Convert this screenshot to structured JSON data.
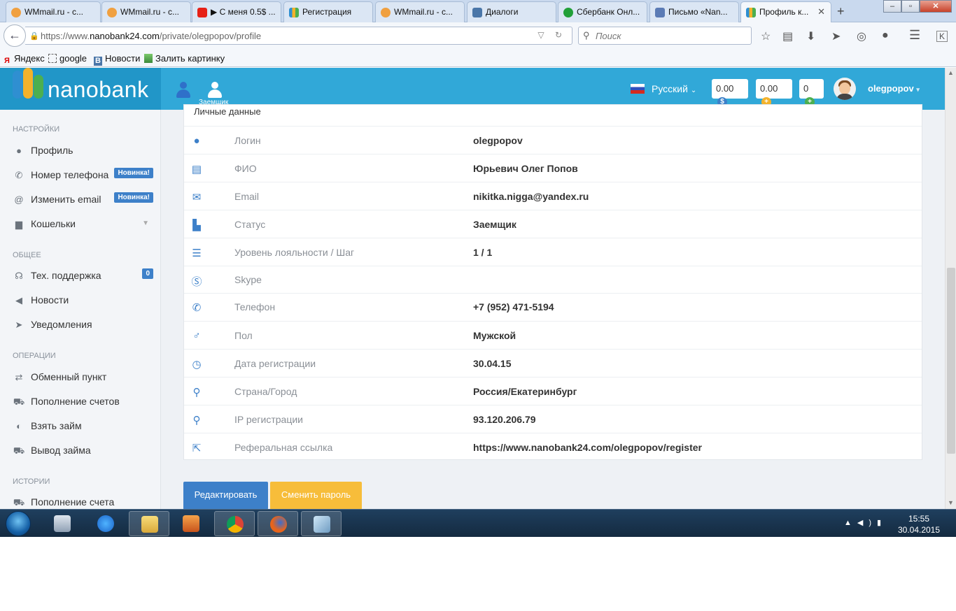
{
  "browser": {
    "tabs": [
      {
        "title": "WMmail.ru - с...",
        "icon": "wmmail-icon",
        "color": "#f0a040"
      },
      {
        "title": "WMmail.ru - с...",
        "icon": "wmmail-icon",
        "color": "#f0a040"
      },
      {
        "title": "▶ С меня 0.5$ ...",
        "icon": "youtube-icon",
        "color": "#e62117"
      },
      {
        "title": "Регистрация",
        "icon": "nanobank-icon",
        "color": "#4caf50"
      },
      {
        "title": "WMmail.ru - с...",
        "icon": "wmmail-icon",
        "color": "#f0a040"
      },
      {
        "title": "Диалоги",
        "icon": "vk-icon",
        "color": "#4a76a8"
      },
      {
        "title": "Сбербанк Онл...",
        "icon": "sberbank-icon",
        "color": "#21a038"
      },
      {
        "title": "Письмо «Nan...",
        "icon": "mail-icon",
        "color": "#5b7bb5"
      },
      {
        "title": "Профиль к...",
        "icon": "nanobank-icon",
        "color": "#4caf50",
        "active": true
      }
    ],
    "url_prefix": "https://www.",
    "url_host": "nanobank24.com",
    "url_path": "/private/olegpopov/profile",
    "search_placeholder": "Поиск",
    "bookmarks": [
      {
        "label": "Яндекс",
        "icon": "yandex-icon"
      },
      {
        "label": "google",
        "icon": "dashed-square-icon"
      },
      {
        "label": "Новости",
        "icon": "vk-icon"
      },
      {
        "label": "Залить картинку",
        "icon": "image-upload-icon"
      }
    ]
  },
  "header": {
    "logo_text": "nanobank",
    "role_label": "Заемщик",
    "language": "Русский",
    "balances": [
      "0.00",
      "0.00",
      "0"
    ],
    "username": "olegpopov"
  },
  "sidebar": {
    "sections": [
      {
        "title": "НАСТРОЙКИ",
        "items": [
          {
            "label": "Профиль",
            "icon": "user-icon"
          },
          {
            "label": "Номер телефона",
            "icon": "phone-icon",
            "badge": "Новинка!"
          },
          {
            "label": "Изменить email",
            "icon": "at-icon",
            "badge": "Новинка!"
          },
          {
            "label": "Кошельки",
            "icon": "wallet-icon",
            "caret": true
          }
        ]
      },
      {
        "title": "ОБЩЕЕ",
        "items": [
          {
            "label": "Тех. поддержка",
            "icon": "headset-icon",
            "badge": "0"
          },
          {
            "label": "Новости",
            "icon": "megaphone-icon"
          },
          {
            "label": "Уведомления",
            "icon": "paper-plane-icon"
          }
        ]
      },
      {
        "title": "ОПЕРАЦИИ",
        "items": [
          {
            "label": "Обменный пункт",
            "icon": "exchange-icon"
          },
          {
            "label": "Пополнение счетов",
            "icon": "cart-icon"
          },
          {
            "label": "Взять займ",
            "icon": "arrow-circle-icon"
          },
          {
            "label": "Вывод займа",
            "icon": "cart-icon"
          }
        ]
      },
      {
        "title": "ИСТОРИИ",
        "items": [
          {
            "label": "Пополнение счета",
            "icon": "cart-icon"
          }
        ]
      }
    ]
  },
  "profile": {
    "section_title": "Личные данные",
    "rows": [
      {
        "icon": "user-icon",
        "label": "Логин",
        "value": "olegpopov"
      },
      {
        "icon": "clipboard-icon",
        "label": "ФИО",
        "value": "Юрьевич Олег Попов"
      },
      {
        "icon": "envelope-icon",
        "label": "Email",
        "value": "nikitka.nigga@yandex.ru"
      },
      {
        "icon": "bar-chart-icon",
        "label": "Статус",
        "value": "Заемщик"
      },
      {
        "icon": "list-icon",
        "label": "Уровень лояльности / Шаг",
        "value": "1 / 1"
      },
      {
        "icon": "skype-icon",
        "label": "Skype",
        "value": ""
      },
      {
        "icon": "phone-icon",
        "label": "Телефон",
        "value": "+7 (952) 471-5194"
      },
      {
        "icon": "male-icon",
        "label": "Пол",
        "value": "Мужской"
      },
      {
        "icon": "clock-icon",
        "label": "Дата регистрации",
        "value": "30.04.15"
      },
      {
        "icon": "map-marker-icon",
        "label": "Страна/Город",
        "value": "Россия/Екатеринбург"
      },
      {
        "icon": "map-marker-icon",
        "label": "IP регистрации",
        "value": "93.120.206.79"
      },
      {
        "icon": "external-link-icon",
        "label": "Реферальная ссылка",
        "value": "https://www.nanobank24.com/olegpopov/register"
      }
    ],
    "edit_button": "Редактировать",
    "change_password_button": "Сменить пароль"
  },
  "taskbar": {
    "time": "15:55",
    "date": "30.04.2015"
  },
  "colors": {
    "header": "#31a8d8",
    "accent_blue": "#3d80c9",
    "accent_yellow": "#f7bd3a"
  }
}
